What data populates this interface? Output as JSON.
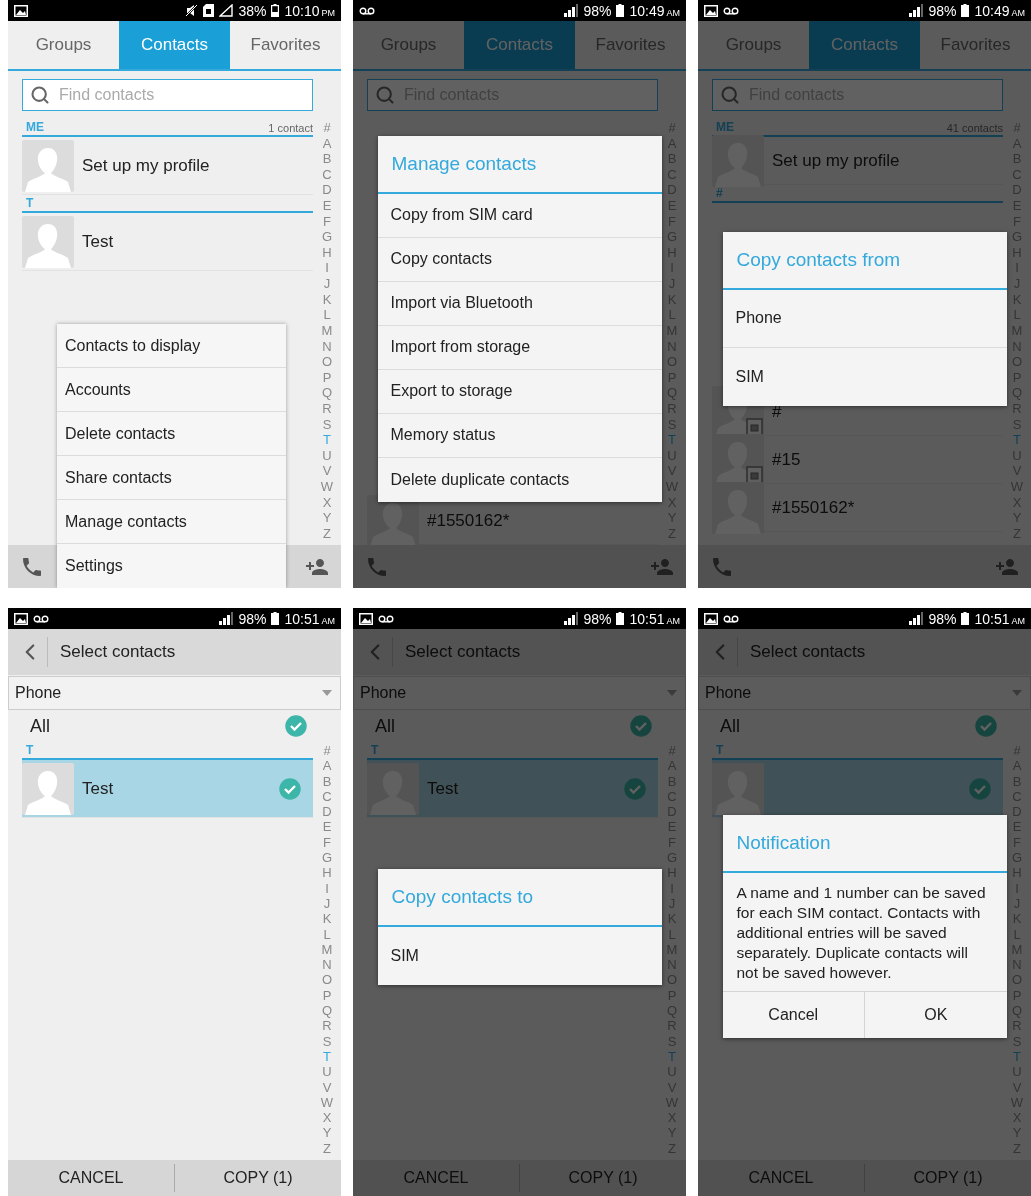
{
  "screens": [
    {
      "kind": "contacts",
      "dimmed": false,
      "status_bar": {
        "kind": "mute",
        "battery": "38%",
        "time": "10:10",
        "meridiem": "PM"
      },
      "tabs": [
        {
          "label": "Groups",
          "selected": false
        },
        {
          "label": "Contacts",
          "selected": true
        },
        {
          "label": "Favorites",
          "selected": false
        }
      ],
      "search": {
        "placeholder": "Find contacts"
      },
      "sections": [
        {
          "header": "ME",
          "count": "1 contact",
          "rows": [
            {
              "name": "Set up my profile",
              "sim": false
            }
          ]
        },
        {
          "header": "T",
          "rows": [
            {
              "name": "Test",
              "sim": false
            }
          ]
        }
      ],
      "index": [
        {
          "letter": "#",
          "selected": false
        },
        {
          "letter": "A",
          "selected": false
        },
        {
          "letter": "B",
          "selected": false
        },
        {
          "letter": "C",
          "selected": false
        },
        {
          "letter": "D",
          "selected": false
        },
        {
          "letter": "E",
          "selected": false
        },
        {
          "letter": "F",
          "selected": false
        },
        {
          "letter": "G",
          "selected": false
        },
        {
          "letter": "H",
          "selected": false
        },
        {
          "letter": "I",
          "selected": false
        },
        {
          "letter": "J",
          "selected": false
        },
        {
          "letter": "K",
          "selected": false
        },
        {
          "letter": "L",
          "selected": false
        },
        {
          "letter": "M",
          "selected": false
        },
        {
          "letter": "N",
          "selected": false
        },
        {
          "letter": "O",
          "selected": false
        },
        {
          "letter": "P",
          "selected": false
        },
        {
          "letter": "Q",
          "selected": false
        },
        {
          "letter": "R",
          "selected": false
        },
        {
          "letter": "S",
          "selected": false
        },
        {
          "letter": "T",
          "selected": true
        },
        {
          "letter": "U",
          "selected": false
        },
        {
          "letter": "V",
          "selected": false
        },
        {
          "letter": "W",
          "selected": false
        },
        {
          "letter": "X",
          "selected": false
        },
        {
          "letter": "Y",
          "selected": false
        },
        {
          "letter": "Z",
          "selected": false
        }
      ],
      "menu": [
        "Contacts to display",
        "Accounts",
        "Delete contacts",
        "Share contacts",
        "Manage contacts",
        "Settings"
      ]
    },
    {
      "kind": "manage",
      "dimmed": true,
      "status_bar": {
        "kind": "voicemail",
        "battery": "98%",
        "time": "10:49",
        "meridiem": "AM"
      },
      "tabs": [
        {
          "label": "Groups",
          "selected": false
        },
        {
          "label": "Contacts",
          "selected": true
        },
        {
          "label": "Favorites",
          "selected": false
        }
      ],
      "search": {
        "placeholder": "Find contacts"
      },
      "sections": [
        {
          "rows": [
            {
              "name": "#1550162*",
              "sim": false
            }
          ]
        }
      ],
      "index": [
        {
          "letter": "#",
          "selected": false
        },
        {
          "letter": "A",
          "selected": false
        },
        {
          "letter": "B",
          "selected": false
        },
        {
          "letter": "C",
          "selected": false
        },
        {
          "letter": "D",
          "selected": false
        },
        {
          "letter": "E",
          "selected": false
        },
        {
          "letter": "F",
          "selected": false
        },
        {
          "letter": "G",
          "selected": false
        },
        {
          "letter": "H",
          "selected": false
        },
        {
          "letter": "I",
          "selected": false
        },
        {
          "letter": "J",
          "selected": false
        },
        {
          "letter": "K",
          "selected": false
        },
        {
          "letter": "L",
          "selected": false
        },
        {
          "letter": "M",
          "selected": false
        },
        {
          "letter": "N",
          "selected": false
        },
        {
          "letter": "O",
          "selected": false
        },
        {
          "letter": "P",
          "selected": false
        },
        {
          "letter": "Q",
          "selected": false
        },
        {
          "letter": "R",
          "selected": false
        },
        {
          "letter": "S",
          "selected": false
        },
        {
          "letter": "T",
          "selected": true
        },
        {
          "letter": "U",
          "selected": false
        },
        {
          "letter": "V",
          "selected": false
        },
        {
          "letter": "W",
          "selected": false
        },
        {
          "letter": "X",
          "selected": false
        },
        {
          "letter": "Y",
          "selected": false
        },
        {
          "letter": "Z",
          "selected": false
        }
      ],
      "dialog": {
        "title": "Manage contacts",
        "items": [
          "Copy from SIM card",
          "Copy contacts",
          "Import via Bluetooth",
          "Import from storage",
          "Export to storage",
          "Memory status",
          "Delete duplicate contacts"
        ]
      }
    },
    {
      "kind": "copy_from",
      "dimmed": true,
      "status_bar": {
        "kind": "both",
        "battery": "98%",
        "time": "10:49",
        "meridiem": "AM"
      },
      "tabs": [
        {
          "label": "Groups",
          "selected": false
        },
        {
          "label": "Contacts",
          "selected": true
        },
        {
          "label": "Favorites",
          "selected": false
        }
      ],
      "search": {
        "placeholder": "Find contacts"
      },
      "sections": [
        {
          "header": "ME",
          "count": "41 contacts",
          "rows": [
            {
              "name": "Set up my profile",
              "sim": false
            }
          ]
        },
        {
          "header": "#",
          "rows": [
            {
              "name": "#",
              "sim": true
            },
            {
              "name": "#15",
              "sim": true
            },
            {
              "name": "#1550162*",
              "sim": false
            }
          ]
        }
      ],
      "index": [
        {
          "letter": "#",
          "selected": false
        },
        {
          "letter": "A",
          "selected": false
        },
        {
          "letter": "B",
          "selected": false
        },
        {
          "letter": "C",
          "selected": false
        },
        {
          "letter": "D",
          "selected": false
        },
        {
          "letter": "E",
          "selected": false
        },
        {
          "letter": "F",
          "selected": false
        },
        {
          "letter": "G",
          "selected": false
        },
        {
          "letter": "H",
          "selected": false
        },
        {
          "letter": "I",
          "selected": false
        },
        {
          "letter": "J",
          "selected": false
        },
        {
          "letter": "K",
          "selected": false
        },
        {
          "letter": "L",
          "selected": false
        },
        {
          "letter": "M",
          "selected": false
        },
        {
          "letter": "N",
          "selected": false
        },
        {
          "letter": "O",
          "selected": false
        },
        {
          "letter": "P",
          "selected": false
        },
        {
          "letter": "Q",
          "selected": false
        },
        {
          "letter": "R",
          "selected": false
        },
        {
          "letter": "S",
          "selected": false
        },
        {
          "letter": "T",
          "selected": true
        },
        {
          "letter": "U",
          "selected": false
        },
        {
          "letter": "V",
          "selected": false
        },
        {
          "letter": "W",
          "selected": false
        },
        {
          "letter": "X",
          "selected": false
        },
        {
          "letter": "Y",
          "selected": false
        },
        {
          "letter": "Z",
          "selected": false
        }
      ],
      "dialog": {
        "title": "Copy contacts from",
        "items": [
          "Phone",
          "SIM"
        ]
      }
    },
    {
      "kind": "select",
      "dimmed": false,
      "status_bar": {
        "kind": "both",
        "battery": "98%",
        "time": "10:51",
        "meridiem": "AM"
      },
      "title": "Select contacts",
      "source": "Phone",
      "all": {
        "label": "All",
        "checked": true
      },
      "sections": [
        {
          "header": "T",
          "rows": [
            {
              "name": "Test",
              "selected": true,
              "checked": true
            }
          ]
        }
      ],
      "index": [
        {
          "letter": "#",
          "selected": false
        },
        {
          "letter": "A",
          "selected": false
        },
        {
          "letter": "B",
          "selected": false
        },
        {
          "letter": "C",
          "selected": false
        },
        {
          "letter": "D",
          "selected": false
        },
        {
          "letter": "E",
          "selected": false
        },
        {
          "letter": "F",
          "selected": false
        },
        {
          "letter": "G",
          "selected": false
        },
        {
          "letter": "H",
          "selected": false
        },
        {
          "letter": "I",
          "selected": false
        },
        {
          "letter": "J",
          "selected": false
        },
        {
          "letter": "K",
          "selected": false
        },
        {
          "letter": "L",
          "selected": false
        },
        {
          "letter": "M",
          "selected": false
        },
        {
          "letter": "N",
          "selected": false
        },
        {
          "letter": "O",
          "selected": false
        },
        {
          "letter": "P",
          "selected": false
        },
        {
          "letter": "Q",
          "selected": false
        },
        {
          "letter": "R",
          "selected": false
        },
        {
          "letter": "S",
          "selected": false
        },
        {
          "letter": "T",
          "selected": true
        },
        {
          "letter": "U",
          "selected": false
        },
        {
          "letter": "V",
          "selected": false
        },
        {
          "letter": "W",
          "selected": false
        },
        {
          "letter": "X",
          "selected": false
        },
        {
          "letter": "Y",
          "selected": false
        },
        {
          "letter": "Z",
          "selected": false
        }
      ],
      "footer": [
        "CANCEL",
        "COPY (1)"
      ]
    },
    {
      "kind": "select",
      "dimmed": true,
      "status_bar": {
        "kind": "both",
        "battery": "98%",
        "time": "10:51",
        "meridiem": "AM"
      },
      "title": "Select contacts",
      "source": "Phone",
      "all": {
        "label": "All",
        "checked": true
      },
      "sections": [
        {
          "header": "T",
          "rows": [
            {
              "name": "Test",
              "selected": true,
              "checked": true
            }
          ]
        }
      ],
      "index": [
        {
          "letter": "#",
          "selected": false
        },
        {
          "letter": "A",
          "selected": false
        },
        {
          "letter": "B",
          "selected": false
        },
        {
          "letter": "C",
          "selected": false
        },
        {
          "letter": "D",
          "selected": false
        },
        {
          "letter": "E",
          "selected": false
        },
        {
          "letter": "F",
          "selected": false
        },
        {
          "letter": "G",
          "selected": false
        },
        {
          "letter": "H",
          "selected": false
        },
        {
          "letter": "I",
          "selected": false
        },
        {
          "letter": "J",
          "selected": false
        },
        {
          "letter": "K",
          "selected": false
        },
        {
          "letter": "L",
          "selected": false
        },
        {
          "letter": "M",
          "selected": false
        },
        {
          "letter": "N",
          "selected": false
        },
        {
          "letter": "O",
          "selected": false
        },
        {
          "letter": "P",
          "selected": false
        },
        {
          "letter": "Q",
          "selected": false
        },
        {
          "letter": "R",
          "selected": false
        },
        {
          "letter": "S",
          "selected": false
        },
        {
          "letter": "T",
          "selected": true
        },
        {
          "letter": "U",
          "selected": false
        },
        {
          "letter": "V",
          "selected": false
        },
        {
          "letter": "W",
          "selected": false
        },
        {
          "letter": "X",
          "selected": false
        },
        {
          "letter": "Y",
          "selected": false
        },
        {
          "letter": "Z",
          "selected": false
        }
      ],
      "footer": [
        "CANCEL",
        "COPY (1)"
      ],
      "dialog": {
        "title": "Copy contacts to",
        "items": [
          "SIM"
        ]
      }
    },
    {
      "kind": "select",
      "dimmed": true,
      "status_bar": {
        "kind": "both",
        "battery": "98%",
        "time": "10:51",
        "meridiem": "AM"
      },
      "title": "Select contacts",
      "source": "Phone",
      "all": {
        "label": "All",
        "checked": true
      },
      "sections": [
        {
          "header": "T",
          "rows": [
            {
              "selected": true,
              "checked": true
            }
          ]
        }
      ],
      "index": [
        {
          "letter": "#",
          "selected": false
        },
        {
          "letter": "A",
          "selected": false
        },
        {
          "letter": "B",
          "selected": false
        },
        {
          "letter": "C",
          "selected": false
        },
        {
          "letter": "D",
          "selected": false
        },
        {
          "letter": "E",
          "selected": false
        },
        {
          "letter": "F",
          "selected": false
        },
        {
          "letter": "G",
          "selected": false
        },
        {
          "letter": "H",
          "selected": false
        },
        {
          "letter": "I",
          "selected": false
        },
        {
          "letter": "J",
          "selected": false
        },
        {
          "letter": "K",
          "selected": false
        },
        {
          "letter": "L",
          "selected": false
        },
        {
          "letter": "M",
          "selected": false
        },
        {
          "letter": "N",
          "selected": false
        },
        {
          "letter": "O",
          "selected": false
        },
        {
          "letter": "P",
          "selected": false
        },
        {
          "letter": "Q",
          "selected": false
        },
        {
          "letter": "R",
          "selected": false
        },
        {
          "letter": "S",
          "selected": false
        },
        {
          "letter": "T",
          "selected": true
        },
        {
          "letter": "U",
          "selected": false
        },
        {
          "letter": "V",
          "selected": false
        },
        {
          "letter": "W",
          "selected": false
        },
        {
          "letter": "X",
          "selected": false
        },
        {
          "letter": "Y",
          "selected": false
        },
        {
          "letter": "Z",
          "selected": false
        }
      ],
      "footer": [
        "CANCEL",
        "COPY (1)"
      ],
      "dialog": {
        "title": "Notification",
        "message": "A name and 1 number can be saved for each SIM contact. Contacts with additional entries will be saved separately. Duplicate contacts will not be saved however.",
        "buttons": [
          "Cancel",
          "OK"
        ]
      }
    }
  ]
}
